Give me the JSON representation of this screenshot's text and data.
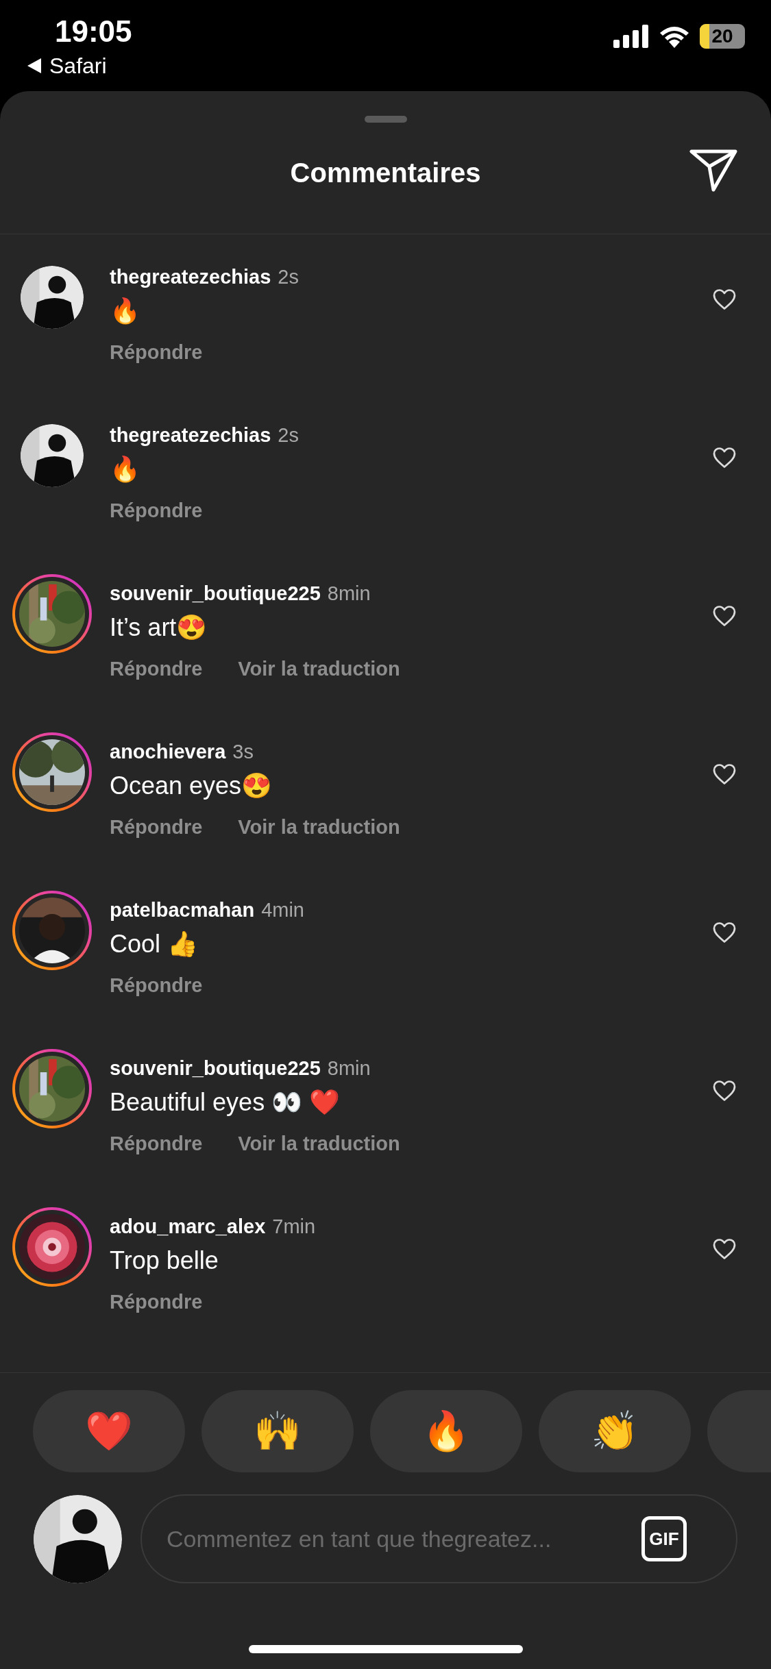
{
  "status_bar": {
    "time": "19:05",
    "back_app": "Safari",
    "battery": "20"
  },
  "header": {
    "title": "Commentaires"
  },
  "comments": [
    {
      "user": "thegreatezechias",
      "time": "2s",
      "text": "🔥",
      "story_ring": false,
      "liked": false,
      "actions": [
        "Répondre"
      ]
    },
    {
      "user": "thegreatezechias",
      "time": "2s",
      "text": "🔥",
      "story_ring": false,
      "liked": false,
      "actions": [
        "Répondre"
      ]
    },
    {
      "user": "souvenir_boutique225",
      "time": "8min",
      "text": "It’s art😍",
      "story_ring": true,
      "liked": false,
      "actions": [
        "Répondre",
        "Voir la traduction"
      ]
    },
    {
      "user": "anochievera",
      "time": "3s",
      "text": "Ocean eyes😍",
      "story_ring": true,
      "liked": false,
      "actions": [
        "Répondre",
        "Voir la traduction"
      ]
    },
    {
      "user": "patelbacmahan",
      "time": "4min",
      "text": "Cool 👍",
      "story_ring": true,
      "liked": false,
      "actions": [
        "Répondre"
      ]
    },
    {
      "user": "souvenir_boutique225",
      "time": "8min",
      "text": "Beautiful eyes 👀 ❤️",
      "story_ring": true,
      "liked": false,
      "actions": [
        "Répondre",
        "Voir la traduction"
      ]
    },
    {
      "user": "adou_marc_alex",
      "time": "7min",
      "text": "Trop belle",
      "story_ring": true,
      "liked": false,
      "actions": [
        "Répondre"
      ]
    }
  ],
  "reactions": [
    "❤️",
    "🙌",
    "🔥",
    "👏"
  ],
  "composer": {
    "placeholder": "Commentez en tant que thegreatez...",
    "gif": "GIF"
  }
}
